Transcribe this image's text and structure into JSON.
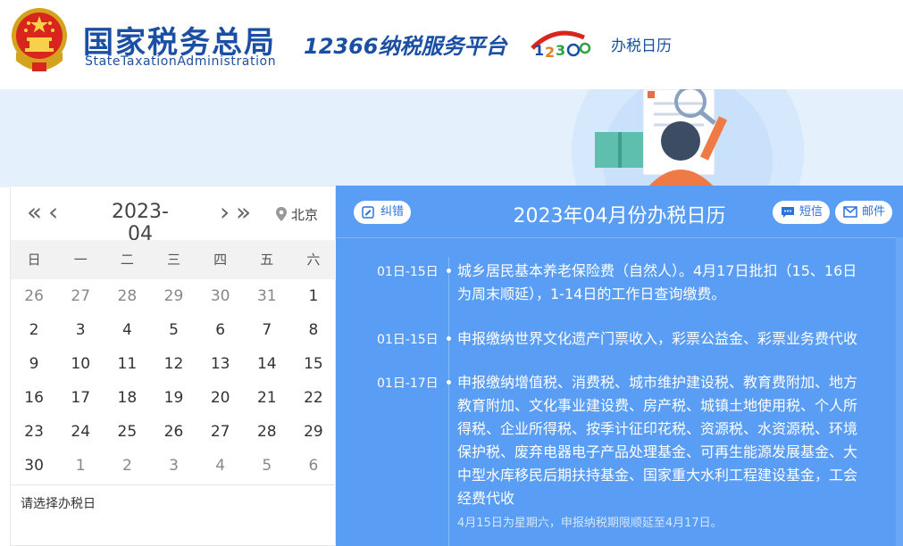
{
  "header": {
    "brand_cn": "国家税务总局",
    "brand_en": "StateTaxationAdministration",
    "platform": "12366纳税服务平台",
    "nav_link": "办税日历"
  },
  "calendar": {
    "month": "2023-04",
    "location": "北京",
    "weekdays": [
      "日",
      "一",
      "二",
      "三",
      "四",
      "五",
      "六"
    ],
    "weeks": [
      [
        "26",
        "27",
        "28",
        "29",
        "30",
        "31",
        "1"
      ],
      [
        "2",
        "3",
        "4",
        "5",
        "6",
        "7",
        "8"
      ],
      [
        "9",
        "10",
        "11",
        "12",
        "13",
        "14",
        "15"
      ],
      [
        "16",
        "17",
        "18",
        "19",
        "20",
        "21",
        "22"
      ],
      [
        "23",
        "24",
        "25",
        "26",
        "27",
        "28",
        "29"
      ],
      [
        "30",
        "1",
        "2",
        "3",
        "4",
        "5",
        "6"
      ]
    ],
    "prompt": "请选择办税日"
  },
  "panel": {
    "title": "2023年04月份办税日历",
    "correct_label": "纠错",
    "sms_label": "短信",
    "mail_label": "邮件",
    "entries": [
      {
        "date": "01日-15日",
        "text": "城乡居民基本养老保险费（自然人）。4月17日批扣（15、16日为周末顺延），1-14日的工作日查询缴费。"
      },
      {
        "date": "01日-15日",
        "text": "申报缴纳世界文化遗产门票收入，彩票公益金、彩票业务费代收"
      },
      {
        "date": "01日-17日",
        "text": "申报缴纳增值税、消费税、城市维护建设税、教育费附加、地方教育附加、文化事业建设费、房产税、城镇土地使用税、个人所得税、企业所得税、按季计征印花税、资源税、水资源税、环境保护税、废弃电器电子产品处理基金、可再生能源发展基金、大中型水库移民后期扶持基金、国家重大水利工程建设基金，工会经费代收",
        "note": "4月15日为星期六，申报纳税期限顺延至4月17日。"
      }
    ]
  },
  "colors": {
    "brand_blue": "#1a4fa3",
    "panel_blue": "#5a9df5",
    "banner_bg": "#e4f0fc"
  },
  "icons": [
    "national-emblem-icon",
    "location-pin-icon",
    "correction-icon",
    "sms-icon",
    "mail-icon"
  ]
}
